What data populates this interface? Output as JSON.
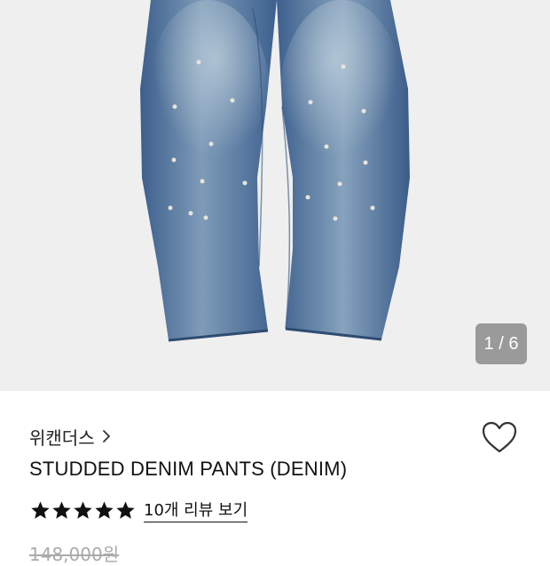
{
  "gallery": {
    "counter": "1 / 6",
    "image_icon": "denim-pants-photo"
  },
  "product": {
    "brand": "위캔더스",
    "brand_chevron_icon": "chevron-right-icon",
    "wishlist_icon": "heart-outline-icon",
    "title": "STUDDED DENIM PANTS (DENIM)",
    "rating_stars": 5,
    "star_icon": "star-filled-icon",
    "review_link": "10개 리뷰 보기",
    "original_price": "148,000원"
  },
  "colors": {
    "gallery_bg": "#efefef",
    "denim_dark": "#3f628e",
    "denim_light": "#9fb7cc",
    "counter_bg": "#9a9a9a",
    "text": "#111111",
    "price_gray": "#aaaaaa"
  }
}
